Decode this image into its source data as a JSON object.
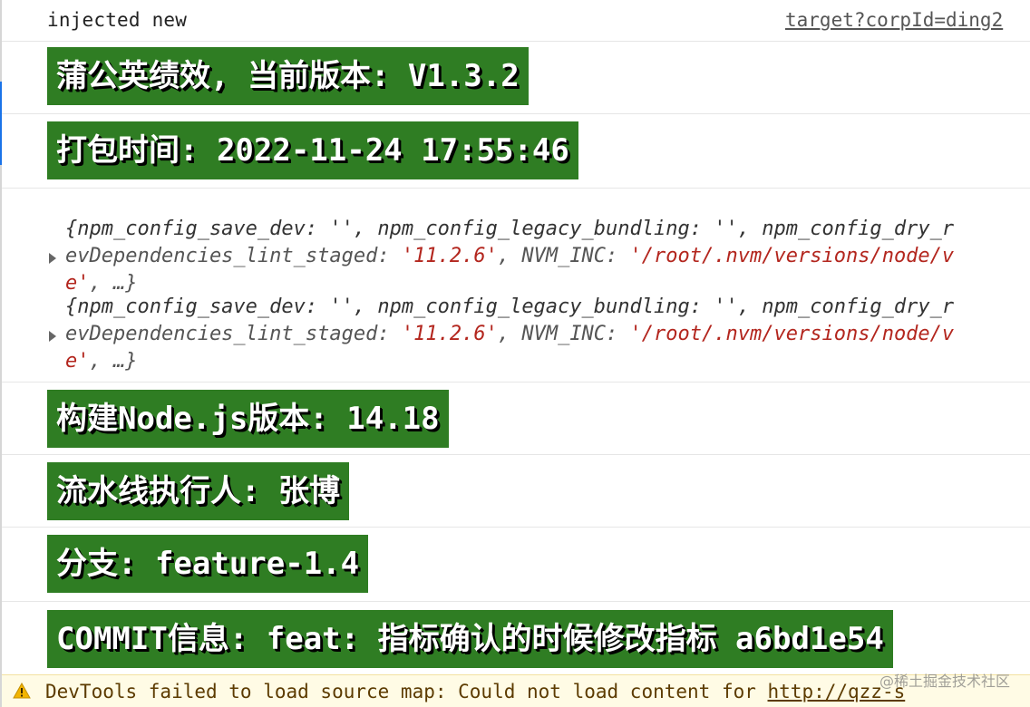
{
  "console": {
    "injected_text": "injected new",
    "source_link": "target?corpId=ding2",
    "version_badge": "蒲公英绩效, 当前版本: V1.3.2",
    "build_time_badge": "打包时间: 2022-11-24 17:55:46",
    "object_logs": [
      {
        "line1": "{npm_config_save_dev: '', npm_config_legacy_bundling: '', npm_config_dry_r",
        "line2_key1": "evDependencies_lint_staged: ",
        "line2_val1": "'11.2.6'",
        "line2_key2": ", NVM_INC: ",
        "line2_val2": "'/root/.nvm/versions/node/v",
        "line3_val": "e'",
        "line3_rest": ", …}"
      },
      {
        "line1": "{npm_config_save_dev: '', npm_config_legacy_bundling: '', npm_config_dry_r",
        "line2_key1": "evDependencies_lint_staged: ",
        "line2_val1": "'11.2.6'",
        "line2_key2": ", NVM_INC: ",
        "line2_val2": "'/root/.nvm/versions/node/v",
        "line3_val": "e'",
        "line3_rest": ", …}"
      }
    ],
    "node_badge": "构建Node.js版本: 14.18",
    "executor_badge": "流水线执行人: 张博",
    "branch_badge": "分支: feature-1.4",
    "commit_badge": "COMMIT信息: feat: 指标确认的时候修改指标 a6bd1e54"
  },
  "warning": {
    "icon": "warning-triangle-icon",
    "text": "DevTools failed to load source map: Could not load content for ",
    "link": "http://qzz-s"
  },
  "watermark": "@稀土掘金技术社区",
  "colors": {
    "badge_bg": "#2f7d23",
    "string_value": "#b3261e",
    "warning_bg": "#fffbe5",
    "accent": "#1a73e8"
  }
}
